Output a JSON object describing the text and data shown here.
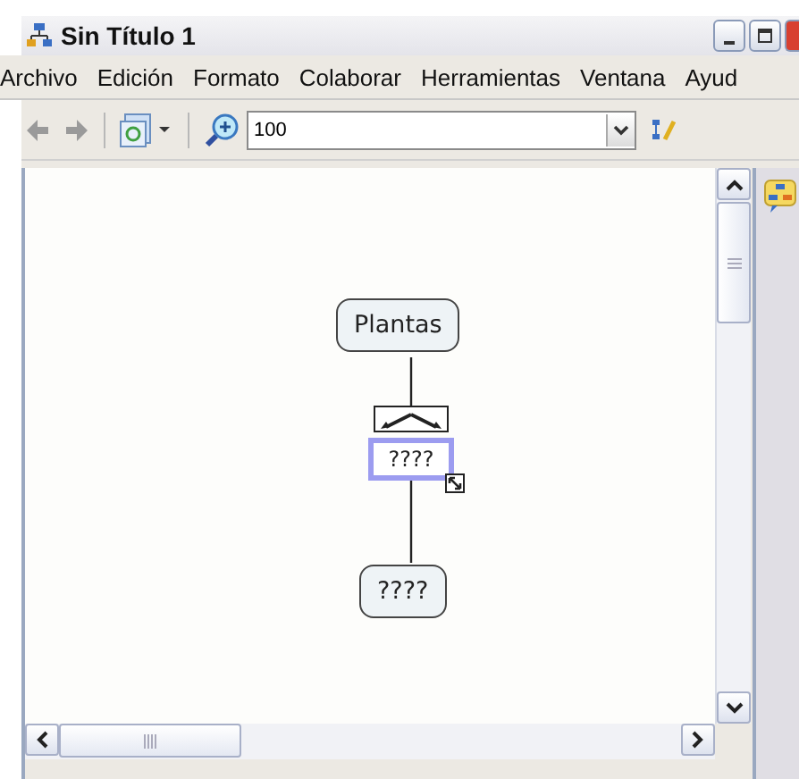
{
  "window": {
    "title": "Sin Título 1"
  },
  "menu": [
    "Archivo",
    "Edición",
    "Formato",
    "Colaborar",
    "Herramientas",
    "Ventana",
    "Ayud"
  ],
  "toolbar": {
    "zoom": "100"
  },
  "map": {
    "concepts": [
      {
        "label": "Plantas"
      },
      {
        "label": "????"
      }
    ],
    "linking_phrase": {
      "label": "????",
      "selected": true
    }
  }
}
